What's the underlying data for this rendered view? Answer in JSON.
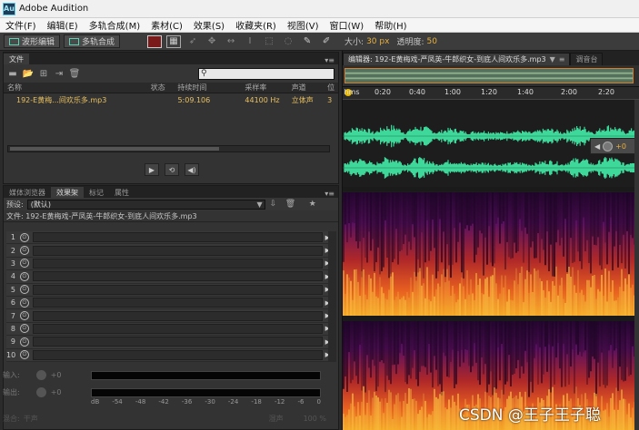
{
  "window": {
    "app_logo": "Au",
    "title": "Adobe Audition"
  },
  "menu": [
    "文件(F)",
    "编辑(E)",
    "多轨合成(M)",
    "素材(C)",
    "效果(S)",
    "收藏夹(R)",
    "视图(V)",
    "窗口(W)",
    "帮助(H)"
  ],
  "toolbar": {
    "waveform_label": "波形编辑",
    "multitrack_label": "多轨合成",
    "size_label": "大小:",
    "size_value": "30 px",
    "opacity_label": "透明度:",
    "opacity_value": "50",
    "tool_icons": [
      "move-tool-icon",
      "hand-tool-icon",
      "time-select-icon",
      "text-cursor-icon",
      "marquee-icon",
      "lasso-icon",
      "brush-icon",
      "spot-heal-icon"
    ]
  },
  "files_panel": {
    "tab": "文件",
    "menu_glyph": "▾≡",
    "columns": [
      "名称",
      "状态",
      "持续时间",
      "采样率",
      "声道",
      "位"
    ],
    "rows": [
      {
        "name": "192-E黄梅...间欢乐多.mp3",
        "status": "",
        "duration": "5:09.106",
        "sample_rate": "44100 Hz",
        "channels": "立体声",
        "bit": "3"
      }
    ]
  },
  "effects_panel": {
    "tabs": [
      "媒体浏览器",
      "效果架",
      "标记",
      "属性"
    ],
    "active_tab": "效果架",
    "menu_glyph": "▾≡",
    "preset_label": "预设:",
    "preset_value": "(默认)",
    "file_line": "文件: 192-E黄梅戏-严凤英-牛郎织女-到底人间欢乐多.mp3",
    "slots": [
      {
        "n": "1"
      },
      {
        "n": "2"
      },
      {
        "n": "3"
      },
      {
        "n": "4"
      },
      {
        "n": "5"
      },
      {
        "n": "6"
      },
      {
        "n": "7"
      },
      {
        "n": "8"
      },
      {
        "n": "9"
      },
      {
        "n": "10"
      }
    ],
    "input_label": "输入:",
    "input_value": "+0",
    "output_label": "输出:",
    "output_value": "+0",
    "meter_ticks": [
      "dB",
      "-54",
      "-48",
      "-42",
      "-36",
      "-30",
      "-24",
      "-18",
      "-12",
      "-6",
      "0"
    ],
    "mix_label": "混合:",
    "mix_dry": "干声",
    "mix_wet": "湿声",
    "mix_value": "100 %"
  },
  "editor": {
    "tab_label": "编辑器: 192-E黄梅戏-严凤英-牛郎织女-到底人间欢乐多.mp3",
    "tab_menu_glyph": "≡",
    "mixer_tab": "调音台",
    "time_labels": [
      "hms",
      "0:20",
      "0:40",
      "1:00",
      "1:20",
      "1:40",
      "2:00",
      "2:20"
    ],
    "volume_value": "+0"
  },
  "watermark": "CSDN @王子王子聪",
  "colors": {
    "waveform": "#3ed89a",
    "background": "#2b2b2b",
    "accent": "#e8b040"
  }
}
